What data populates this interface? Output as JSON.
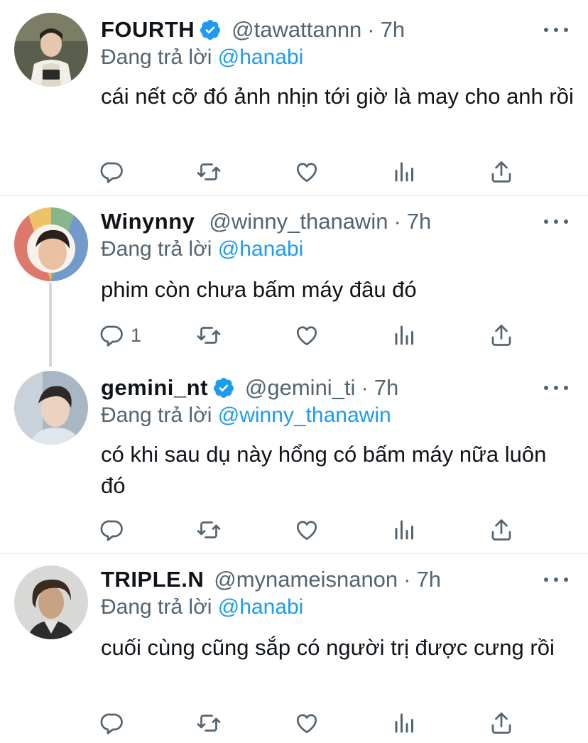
{
  "reply_prefix": "Đang trả lời",
  "colors": {
    "accent": "#1d9bf0",
    "muted": "#536471",
    "text": "#0f1419",
    "divider": "#eff3f4"
  },
  "action_icons": [
    "reply-icon",
    "retweet-icon",
    "like-icon",
    "analytics-icon",
    "share-icon"
  ],
  "tweets": [
    {
      "name": "FOURTH",
      "verified": true,
      "handle": "@tawattannn",
      "separator": "·",
      "time": "7h",
      "reply_to": "@hanabi",
      "text": "cái nết cỡ đó ảnh nhịn tới giờ là may cho anh rồi",
      "reply_count": ""
    },
    {
      "name": "Winynny",
      "verified": false,
      "handle": "@winny_thanawin",
      "separator": "·",
      "time": "7h",
      "reply_to": "@hanabi",
      "text": "phim còn chưa bấm máy đâu đó",
      "reply_count": "1"
    },
    {
      "name": "gemini_nt",
      "verified": true,
      "handle": "@gemini_ti",
      "separator": "·",
      "time": "7h",
      "reply_to": "@winny_thanawin",
      "text": "có khi sau dụ này hổng có bấm máy nữa luôn đó",
      "reply_count": ""
    },
    {
      "name": "TRIPLE.N",
      "verified": false,
      "handle": "@mynameisnanon",
      "separator": "·",
      "time": "7h",
      "reply_to": "@hanabi",
      "text": "cuối cùng cũng sắp có người trị được cưng rồi",
      "reply_count": ""
    }
  ]
}
